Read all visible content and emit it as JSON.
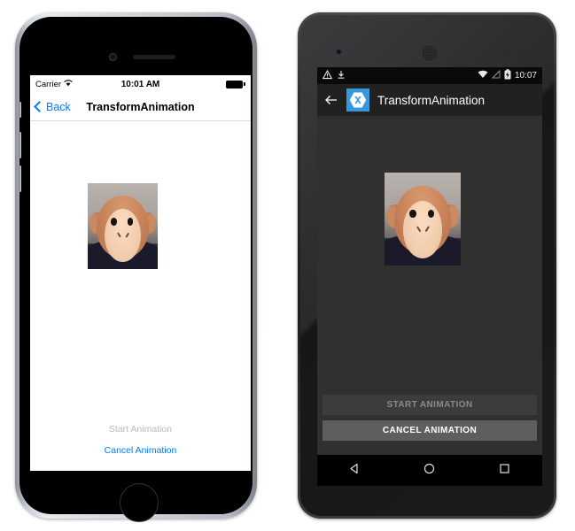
{
  "ios": {
    "status": {
      "carrier": "Carrier",
      "wifi_icon": "wifi-icon",
      "time": "10:01 AM",
      "battery_icon": "battery-full-icon"
    },
    "nav": {
      "back_label": "Back",
      "back_icon": "chevron-left-icon",
      "title": "TransformAnimation"
    },
    "image": {
      "name": "monkey-image",
      "alt": "plush monkey photo"
    },
    "buttons": [
      {
        "label": "Start Animation",
        "state": "disabled"
      },
      {
        "label": "Cancel Animation",
        "state": "enabled"
      }
    ],
    "colors": {
      "tint": "#007aff",
      "disabled_text": "#b9b9bd",
      "background": "#ffffff"
    },
    "device": {
      "home_button": "home-button",
      "camera": "front-camera",
      "speaker": "earpiece-speaker"
    }
  },
  "android": {
    "status": {
      "warning_icon": "warning-triangle-icon",
      "download_icon": "download-icon",
      "wifi_icon": "wifi-icon",
      "signal_icon": "signal-off-icon",
      "battery_icon": "battery-charging-icon",
      "time": "10:07"
    },
    "appbar": {
      "back_icon": "arrow-back-icon",
      "logo_icon": "xamarin-logo-icon",
      "title": "TransformAnimation"
    },
    "image": {
      "name": "monkey-image",
      "alt": "plush monkey photo"
    },
    "buttons": [
      {
        "label": "START ANIMATION",
        "state": "disabled"
      },
      {
        "label": "CANCEL ANIMATION",
        "state": "enabled"
      }
    ],
    "navbar": {
      "back_icon": "nav-back-triangle-icon",
      "home_icon": "nav-home-circle-icon",
      "recents_icon": "nav-recents-square-icon"
    },
    "colors": {
      "accent": "#3498db",
      "appbar": "#212121",
      "background": "#303030",
      "button_disabled": "#3c3c3c",
      "button_enabled": "#5e5e5e"
    },
    "device": {
      "camera": "front-camera",
      "speaker": "earpiece-speaker"
    }
  }
}
